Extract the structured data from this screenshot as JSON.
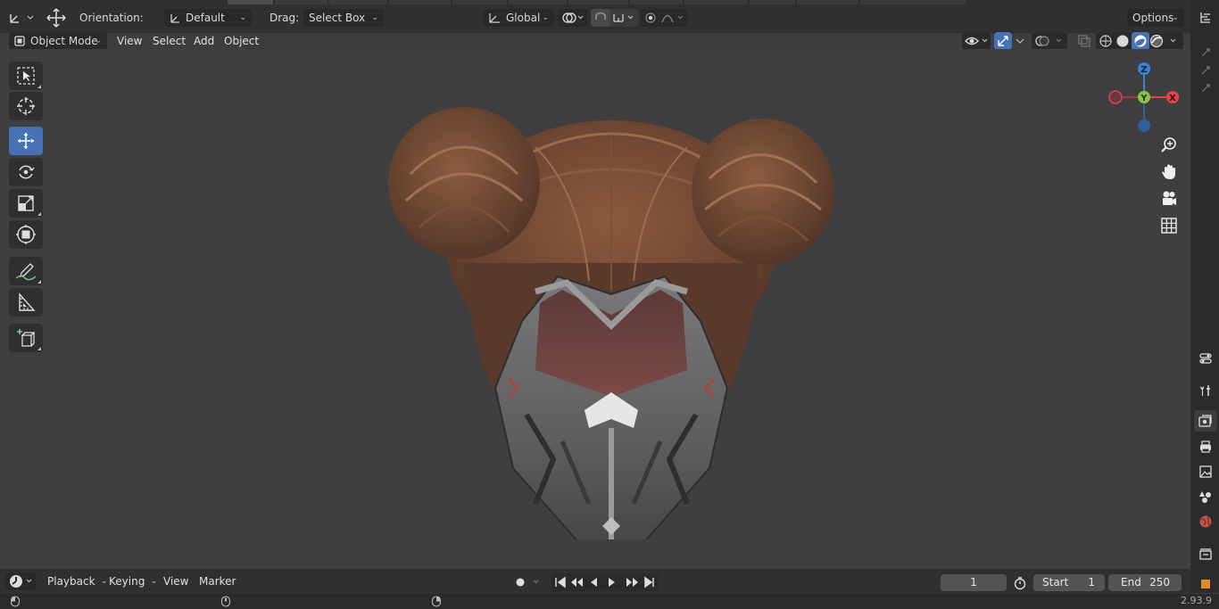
{
  "header": {
    "orientation_label": "Orientation:",
    "orientation_value": "Default",
    "drag_label": "Drag:",
    "drag_value": "Select Box",
    "transform_orientation": "Global",
    "options_label": "Options"
  },
  "viewport_header": {
    "mode": "Object Mode",
    "menu": [
      "View",
      "Select",
      "Add",
      "Object"
    ]
  },
  "gizmo": {
    "z": "Z",
    "y": "Y",
    "x": "X"
  },
  "timeline": {
    "menu": [
      "Playback",
      "Keying",
      "View",
      "Marker"
    ],
    "current_frame": "1",
    "start_label": "Start",
    "start_value": "1",
    "end_label": "End",
    "end_value": "250"
  },
  "status": {
    "version": "2.93.9"
  },
  "icons": {
    "toolbar": [
      "select-box-icon",
      "cursor-icon",
      "move-icon",
      "rotate-icon",
      "scale-icon",
      "transform-icon",
      "annotate-icon",
      "measure-icon",
      "add-cube-icon"
    ],
    "nav": [
      "zoom-icon",
      "hand-icon",
      "camera-icon",
      "grid-icon"
    ]
  },
  "colors": {
    "accent": "#4772b3",
    "axis_x": "#e0424f",
    "axis_y": "#8bc34a",
    "axis_z": "#3d80d4"
  }
}
